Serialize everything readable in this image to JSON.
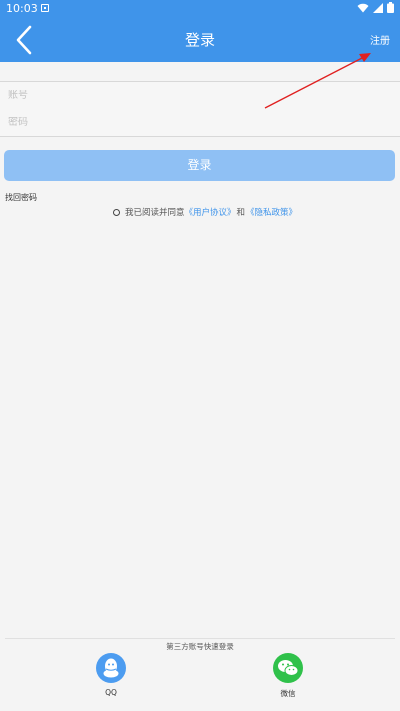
{
  "status_bar": {
    "time": "10:03",
    "icons": [
      "app-notification-icon",
      "wifi-icon",
      "signal-icon",
      "battery-icon"
    ]
  },
  "header": {
    "title": "登录",
    "back_icon": "chevron-left-icon",
    "register_label": "注册"
  },
  "form": {
    "account_placeholder": "账号",
    "password_placeholder": "密码",
    "login_button_label": "登录",
    "forgot_password_label": "找回密码"
  },
  "agreement": {
    "prefix": "我已阅读并同意",
    "user_agreement": "《用户协议》",
    "and": "和",
    "privacy_policy": "《隐私政策》"
  },
  "third_party": {
    "title": "第三方账号快速登录",
    "qq_label": "QQ",
    "wechat_label": "微信"
  },
  "colors": {
    "primary": "#3f94ea",
    "login_button": "#8fc0f4",
    "qq": "#4c9cf0",
    "wechat": "#2fc14a",
    "annotation_arrow": "#e02020"
  }
}
